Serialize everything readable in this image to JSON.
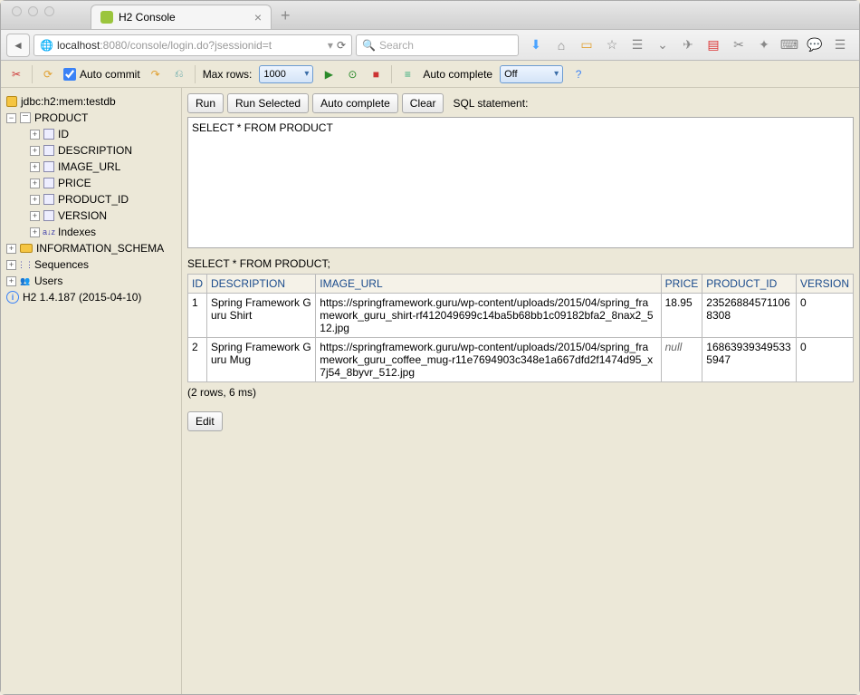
{
  "browser": {
    "tab_title": "H2 Console",
    "url_host": "localhost",
    "url_port": ":8080",
    "url_path": "/console/login.do?jsessionid=t",
    "search_placeholder": "Search"
  },
  "toolbar": {
    "auto_commit_label": "Auto commit",
    "max_rows_label": "Max rows:",
    "max_rows_value": "1000",
    "auto_complete_label": "Auto complete",
    "auto_complete_value": "Off"
  },
  "tree": {
    "db": "jdbc:h2:mem:testdb",
    "table": "PRODUCT",
    "columns": [
      "ID",
      "DESCRIPTION",
      "IMAGE_URL",
      "PRICE",
      "PRODUCT_ID",
      "VERSION"
    ],
    "indexes_label": "Indexes",
    "info_schema": "INFORMATION_SCHEMA",
    "sequences": "Sequences",
    "users": "Users",
    "version": "H2 1.4.187 (2015-04-10)"
  },
  "sql": {
    "run": "Run",
    "run_selected": "Run Selected",
    "auto_complete": "Auto complete",
    "clear": "Clear",
    "label": "SQL statement:",
    "statement": "SELECT * FROM PRODUCT"
  },
  "results": {
    "query": "SELECT * FROM PRODUCT;",
    "headers": [
      "ID",
      "DESCRIPTION",
      "IMAGE_URL",
      "PRICE",
      "PRODUCT_ID",
      "VERSION"
    ],
    "rows": [
      {
        "id": "1",
        "description": "Spring Framework Guru Shirt",
        "image_url": "https://springframework.guru/wp-content/uploads/2015/04/spring_framework_guru_shirt-rf412049699c14ba5b68bb1c09182bfa2_8nax2_512.jpg",
        "price": "18.95",
        "product_id": "235268845711068308",
        "version": "0"
      },
      {
        "id": "2",
        "description": "Spring Framework Guru Mug",
        "image_url": "https://springframework.guru/wp-content/uploads/2015/04/spring_framework_guru_coffee_mug-r11e7694903c348e1a667dfd2f1474d95_x7j54_8byvr_512.jpg",
        "price": null,
        "product_id": "168639393495335947",
        "version": "0"
      }
    ],
    "summary": "(2 rows, 6 ms)",
    "edit": "Edit"
  }
}
